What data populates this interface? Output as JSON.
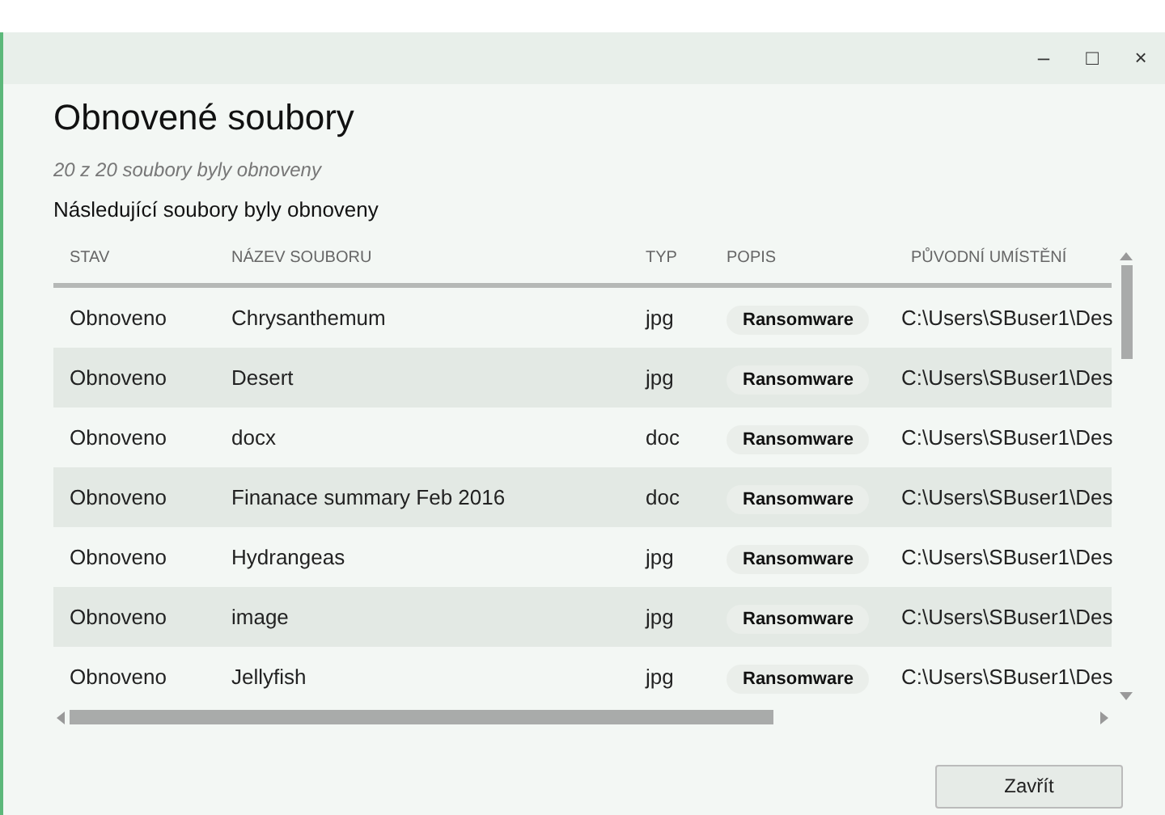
{
  "window": {
    "controls": [
      "‒",
      "□",
      "×"
    ]
  },
  "title": "Obnovené soubory",
  "summary": "20 z 20 soubory byly obnoveny",
  "caption": "Následující soubory byly obnoveny",
  "table": {
    "columns": [
      "STAV",
      "NÁZEV SOUBORU",
      "TYP",
      "POPIS",
      "PŮVODNÍ UMÍSTĚNÍ"
    ],
    "rows": [
      {
        "status": "Obnoveno",
        "name": "Chrysanthemum",
        "type": "jpg",
        "description": "Ransomware",
        "location": "C:\\Users\\SBuser1\\Des"
      },
      {
        "status": "Obnoveno",
        "name": "Desert",
        "type": "jpg",
        "description": "Ransomware",
        "location": "C:\\Users\\SBuser1\\Des"
      },
      {
        "status": "Obnoveno",
        "name": "docx",
        "type": "doc",
        "description": "Ransomware",
        "location": "C:\\Users\\SBuser1\\Des"
      },
      {
        "status": "Obnoveno",
        "name": "Finanace summary Feb 2016",
        "type": "doc",
        "description": "Ransomware",
        "location": "C:\\Users\\SBuser1\\Des"
      },
      {
        "status": "Obnoveno",
        "name": "Hydrangeas",
        "type": "jpg",
        "description": "Ransomware",
        "location": "C:\\Users\\SBuser1\\Des"
      },
      {
        "status": "Obnoveno",
        "name": "image",
        "type": "jpg",
        "description": "Ransomware",
        "location": "C:\\Users\\SBuser1\\Des"
      },
      {
        "status": "Obnoveno",
        "name": "Jellyfish",
        "type": "jpg",
        "description": "Ransomware",
        "location": "C:\\Users\\SBuser1\\Des"
      }
    ]
  },
  "close_button": "Zavřít"
}
